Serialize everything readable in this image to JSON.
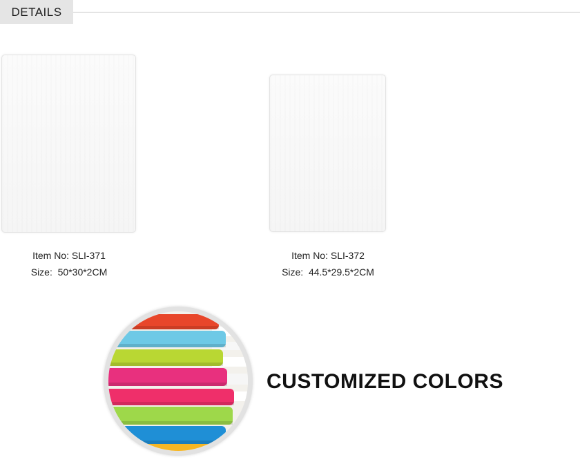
{
  "header": {
    "tab_label": "DETAILS"
  },
  "products": [
    {
      "item_no": "Item No: SLI-371",
      "size": "Size:  50*30*2CM"
    },
    {
      "item_no": "Item No: SLI-372",
      "size": "Size:  44.5*29.5*2CM"
    }
  ],
  "feature": {
    "headline": "CUSTOMIZED COLORS",
    "board_colors": [
      "#e8462a",
      "#6ec9e6",
      "#b9d733",
      "#e8307e",
      "#ef2f6a",
      "#9ed84a",
      "#1f8fd6",
      "#f6b623"
    ]
  }
}
